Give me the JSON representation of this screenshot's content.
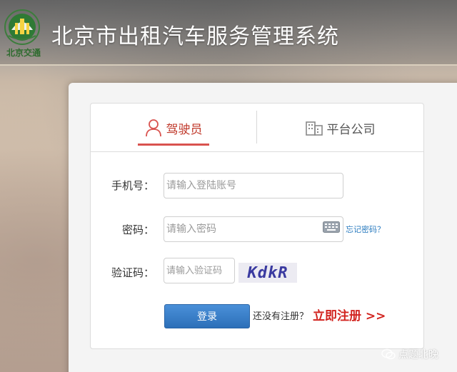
{
  "header": {
    "logo_text": "北京交通",
    "title": "北京市出租汽车服务管理系统"
  },
  "tabs": [
    {
      "label": "驾驶员",
      "icon": "person-icon",
      "active": true
    },
    {
      "label": "平台公司",
      "icon": "building-icon",
      "active": false
    }
  ],
  "form": {
    "phone_label": "手机号：",
    "phone_placeholder": "请输入登陆账号",
    "password_label": "密码：",
    "password_placeholder": "请输入密码",
    "forgot_link": "忘记密码？",
    "captcha_label": "验证码：",
    "captcha_placeholder": "请输入验证码",
    "captcha_image_text": "KdkR",
    "login_button": "登录",
    "no_account_text": "还没有注册？",
    "register_link": "立即注册 >>"
  },
  "watermark": {
    "text": "点题北晚"
  },
  "colors": {
    "accent_red": "#d9534f",
    "register_red": "#d2241f",
    "button_blue": "#2c6fb8",
    "link_blue": "#2a7bbf"
  }
}
